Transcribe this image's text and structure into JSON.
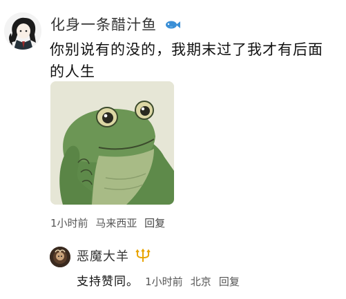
{
  "comment": {
    "username": "化身一条醋汁鱼",
    "username_badge_icon": "fish-icon",
    "text": "你别说有的没的，我期末过了我才有后面的人生",
    "sticker_icon": "thinking-frog-sticker",
    "time": "1小时前",
    "location": "马来西亚",
    "reply_label": "回复"
  },
  "reply": {
    "username": "恶魔大羊",
    "username_badge_icon": "trident-icon",
    "text": "支持赞同。",
    "time": "1小时前",
    "location": "北京",
    "reply_label": "回复"
  },
  "colors": {
    "username": "#333333",
    "text": "#111111",
    "meta": "#555555",
    "badge_fish": "#3b8fd6",
    "badge_trident": "#e8a400"
  }
}
